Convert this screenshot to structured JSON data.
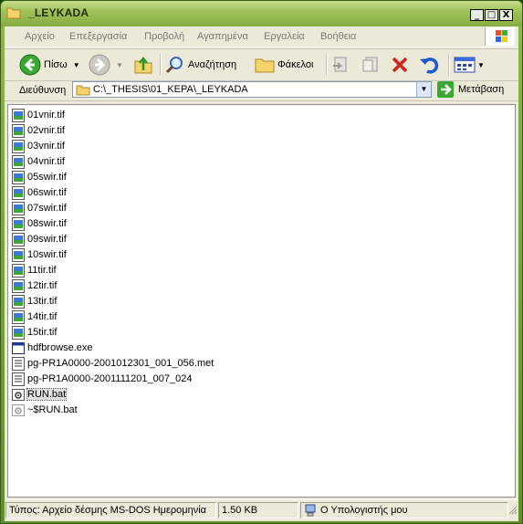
{
  "window": {
    "title": "_LEYKADA",
    "minimize": "_",
    "maximize": "□",
    "close": "X"
  },
  "menu": [
    "Αρχείο",
    "Επεξεργασία",
    "Προβολή",
    "Αγαπημένα",
    "Εργαλεία",
    "Βοήθεια"
  ],
  "toolbar": {
    "back_label": "Πίσω",
    "search_label": "Αναζήτηση",
    "folders_label": "Φάκελοι"
  },
  "address": {
    "label": "Διεύθυνση",
    "path": "C:\\_THESIS\\01_KEPA\\_LEYKADA",
    "go_label": "Μετάβαση"
  },
  "files": [
    {
      "name": "01vnir.tif",
      "icon": "image-file-icon"
    },
    {
      "name": "02vnir.tif",
      "icon": "image-file-icon"
    },
    {
      "name": "03vnir.tif",
      "icon": "image-file-icon"
    },
    {
      "name": "04vnir.tif",
      "icon": "image-file-icon"
    },
    {
      "name": "05swir.tif",
      "icon": "image-file-icon"
    },
    {
      "name": "06swir.tif",
      "icon": "image-file-icon"
    },
    {
      "name": "07swir.tif",
      "icon": "image-file-icon"
    },
    {
      "name": "08swir.tif",
      "icon": "image-file-icon"
    },
    {
      "name": "09swir.tif",
      "icon": "image-file-icon"
    },
    {
      "name": "10swir.tif",
      "icon": "image-file-icon"
    },
    {
      "name": "11tir.tif",
      "icon": "image-file-icon"
    },
    {
      "name": "12tir.tif",
      "icon": "image-file-icon"
    },
    {
      "name": "13tir.tif",
      "icon": "image-file-icon"
    },
    {
      "name": "14tir.tif",
      "icon": "image-file-icon"
    },
    {
      "name": "15tir.tif",
      "icon": "image-file-icon"
    },
    {
      "name": "hdfbrowse.exe",
      "icon": "exe-file-icon"
    },
    {
      "name": "pg-PR1A0000-2001012301_001_056.met",
      "icon": "text-file-icon"
    },
    {
      "name": "pg-PR1A0000-2001111201_007_024",
      "icon": "text-file-icon"
    },
    {
      "name": "RUN.bat",
      "icon": "bat-file-icon",
      "selected": true
    },
    {
      "name": "~$RUN.bat",
      "icon": "bat-file-icon"
    }
  ],
  "status": {
    "type_text": "Τύπος: Αρχείο δέσμης MS-DOS Ημερομηνία",
    "size_text": "1.50 KB",
    "location_text": "Ο Υπολογιστής μου"
  },
  "colors": {
    "titlebar": "#9fc25a",
    "background": "#ece9d8",
    "selection": "#e1e1e1"
  }
}
